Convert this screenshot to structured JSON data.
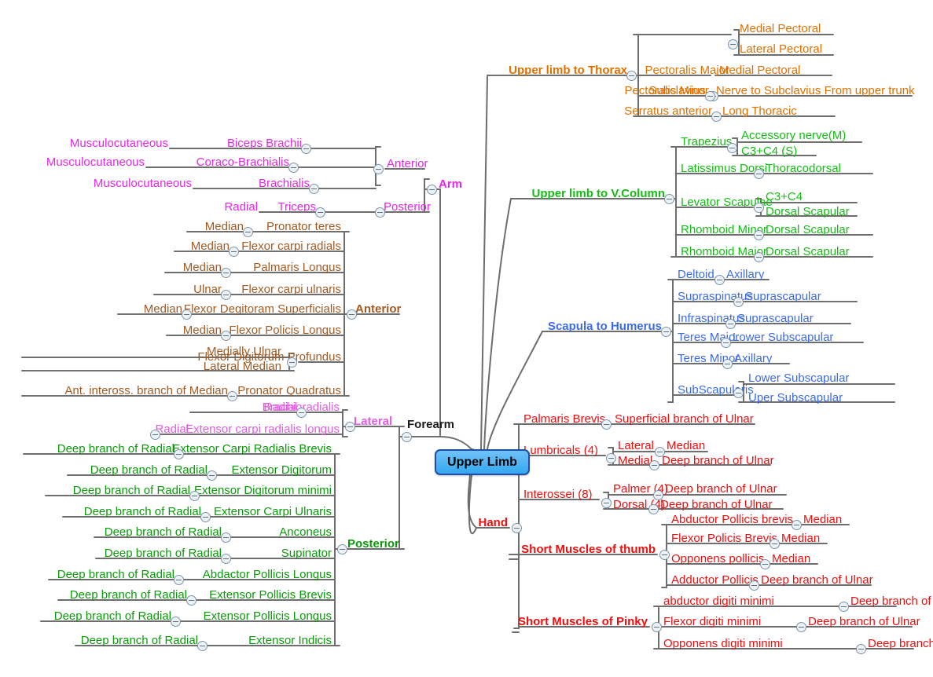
{
  "title": "Upper Limb",
  "root": {
    "label": "Upper Limb"
  },
  "colors": {
    "thorax": "#E07000",
    "vcolumn": "#12BE12",
    "scapula": "#3B6BE8",
    "hand": "#F20D0D",
    "arm": "#E826E8",
    "forearm_anterior": "#A35A22",
    "forearm_lateral": "#E45BE4",
    "forearm_posterior": "#0A9A0A",
    "forearm": "#1A1A1A",
    "root_fill": "#34A8F0",
    "root_border": "#1E4FA8",
    "connector": "#6E6E6E"
  },
  "branches": {
    "thorax": {
      "label": "Upper limb to Thorax",
      "items": [
        {
          "label": "Pectoralis Major",
          "children": [
            "Medial Pectoral",
            "Lateral Pectoral"
          ]
        },
        {
          "label": "Pectoralis Minor",
          "children": [
            "Medial Pectoral"
          ]
        },
        {
          "label": "Subclavius",
          "children": [
            "Nerve to Subclavius From upper trunk"
          ]
        },
        {
          "label": "Serratus anterior",
          "children": [
            "Long Thoracic"
          ]
        }
      ]
    },
    "vcolumn": {
      "label": "Upper limb to V.Column",
      "items": [
        {
          "label": "Trapezius",
          "children": [
            "Accessory nerve(M)",
            "C3+C4 (S)"
          ]
        },
        {
          "label": "Latissimus Dorsi",
          "children": [
            "Thoracodorsal"
          ]
        },
        {
          "label": "Levator Scapulae",
          "children": [
            "C3+C4",
            "Dorsal Scapular"
          ]
        },
        {
          "label": "Rhomboid Minor",
          "children": [
            "Dorsal Scapular"
          ]
        },
        {
          "label": "Rhomboid Major",
          "children": [
            "Dorsal Scapular"
          ]
        }
      ]
    },
    "scapula": {
      "label": "Scapula to Humerus",
      "items": [
        {
          "label": "Deltoid",
          "children": [
            "Axillary"
          ]
        },
        {
          "label": "Supraspinatus",
          "children": [
            "Suprascapular"
          ]
        },
        {
          "label": "Infraspinatus",
          "children": [
            "Suprascapular"
          ]
        },
        {
          "label": "Teres Major",
          "children": [
            "Lower Subscapular"
          ]
        },
        {
          "label": "Teres Minor",
          "children": [
            "Axillary"
          ]
        },
        {
          "label": "SubScapularis",
          "children": [
            "Lower Subscapular",
            "Uper Subscapular"
          ]
        }
      ]
    },
    "hand": {
      "label": "Hand",
      "items": [
        {
          "label": "Palmaris Brevis",
          "children": [
            "Superficial branch of Ulnar"
          ]
        },
        {
          "label": "Lumbricals (4)",
          "children": [
            "Lateral",
            "Medial"
          ],
          "grandchildren": [
            "Median",
            "Deep branch of Ulnar"
          ]
        },
        {
          "label": "Interossei (8)",
          "children": [
            "Palmer (4)",
            "Dorsal (4)"
          ],
          "grandchildren": [
            "Deep branch of Ulnar",
            "Deep branch of Ulnar"
          ]
        },
        {
          "label": "Short Muscles of thumb",
          "children": [
            "Abductor Pollicis brevis",
            "Flexor Policis Brevis",
            "Opponens pollicis",
            "Adductor Pollicis"
          ],
          "grandchildren": [
            "Median",
            "Median",
            "Median",
            "Deep branch of Ulnar"
          ]
        },
        {
          "label": "Short Muscles of Pinky",
          "children": [
            "abductor digiti minimi",
            "Flexor digiti minimi",
            "Opponens digiti minimi"
          ],
          "grandchildren": [
            "Deep branch of Ulnar",
            "Deep branch of Ulnar",
            "Deep branch of Ulnar"
          ]
        }
      ]
    },
    "arm": {
      "label": "Arm",
      "groups": [
        {
          "label": "Anterior",
          "rows": [
            {
              "nerve": "Musculocutaneous",
              "muscle": "Biceps Brachii"
            },
            {
              "nerve": "Musculocutaneous",
              "muscle": "Coraco-Brachialis"
            },
            {
              "nerve": "Musculocutaneous",
              "muscle": "Brachialis"
            }
          ]
        },
        {
          "label": "Posterior",
          "rows": [
            {
              "nerve": "Radial",
              "muscle": "Triceps"
            }
          ]
        }
      ]
    },
    "forearm": {
      "label": "Forearm",
      "groups": [
        {
          "label": "Anterior",
          "rows": [
            {
              "nerve": "Median",
              "muscle": "Pronator teres"
            },
            {
              "nerve": "Median",
              "muscle": "Flexor carpi radials"
            },
            {
              "nerve": "Median",
              "muscle": "Palmaris Longus"
            },
            {
              "nerve": "Ulnar",
              "muscle": "Flexor carpi ulnaris"
            },
            {
              "nerve": "Median",
              "muscle": "Flexor Degitoram Superficialis"
            },
            {
              "nerve": "Median",
              "muscle": "Flexor Policis Longus"
            },
            {
              "nerve": "",
              "muscle": "Flexor Digitorum Profundus",
              "split": [
                "Medially Ulnar",
                "Lateral Median"
              ]
            },
            {
              "nerve": "Ant. inteross. branch of Median",
              "muscle": "Pronator Quadratus"
            }
          ]
        },
        {
          "label": "Lateral",
          "rows": [
            {
              "nerve": "Radial",
              "muscle": "Brachioradialis"
            },
            {
              "nerve": "Radial",
              "muscle": "Extensor carpi radialis longus"
            }
          ]
        },
        {
          "label": "Posterior",
          "rows": [
            {
              "nerve": "Deep branch of Radial",
              "muscle": "Extensor Carpi Radialis Brevis"
            },
            {
              "nerve": "Deep branch of Radial",
              "muscle": "Extensor Digitorum"
            },
            {
              "nerve": "Deep branch of Radial",
              "muscle": "Extensor Digitorum minimi"
            },
            {
              "nerve": "Deep branch of Radial",
              "muscle": "Extensor Carpi Ulnaris"
            },
            {
              "nerve": "Deep branch of Radial",
              "muscle": "Anconeus"
            },
            {
              "nerve": "Deep branch of Radial",
              "muscle": "Supinator"
            },
            {
              "nerve": "Deep branch of Radial",
              "muscle": "Abdactor Pollicis Longus"
            },
            {
              "nerve": "Deep branch of Radial",
              "muscle": "Extensor Pollicis Brevis"
            },
            {
              "nerve": "Deep branch of Radial",
              "muscle": "Extensor Pollicis Longus"
            },
            {
              "nerve": "Deep branch of Radial",
              "muscle": "Extensor Indicis"
            }
          ]
        }
      ]
    }
  },
  "labels": {
    "thorax_title": "Upper limb to Thorax",
    "vcolumn_title": "Upper limb to V.Column",
    "scapula_title": "Scapula to Humerus",
    "hand_title": "Hand",
    "arm_title": "Arm",
    "forearm_title": "Forearm",
    "arm_anterior": "Anterior",
    "arm_posterior": "Posterior",
    "fa_anterior": "Anterior",
    "fa_lateral": "Lateral",
    "fa_posterior": "Posterior",
    "hand_thumb": "Short Muscles of thumb",
    "hand_pinky": "Short Muscles of Pinky"
  }
}
